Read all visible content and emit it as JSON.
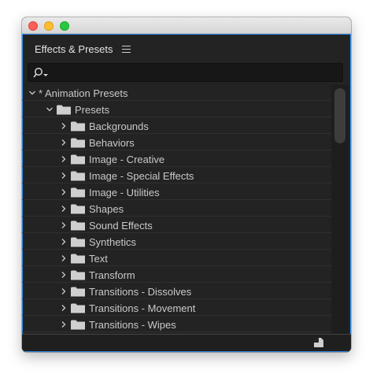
{
  "window": {
    "traffic_lights": [
      {
        "name": "close",
        "color": "#fd5f57"
      },
      {
        "name": "minimize",
        "color": "#febc2e"
      },
      {
        "name": "maximize",
        "color": "#28c840"
      }
    ]
  },
  "panel": {
    "title": "Effects & Presets",
    "menu_icon": "hamburger-menu-icon",
    "accent_color": "#2d8ceb"
  },
  "search": {
    "icon": "search-dropdown-icon",
    "value": "",
    "placeholder": ""
  },
  "tree": [
    {
      "label": "* Animation Presets",
      "level": 0,
      "expanded": true,
      "folder": false
    },
    {
      "label": "Presets",
      "level": 1,
      "expanded": true,
      "folder": true
    },
    {
      "label": "Backgrounds",
      "level": 2,
      "expanded": false,
      "folder": true
    },
    {
      "label": "Behaviors",
      "level": 2,
      "expanded": false,
      "folder": true
    },
    {
      "label": "Image - Creative",
      "level": 2,
      "expanded": false,
      "folder": true
    },
    {
      "label": "Image - Special Effects",
      "level": 2,
      "expanded": false,
      "folder": true
    },
    {
      "label": "Image - Utilities",
      "level": 2,
      "expanded": false,
      "folder": true
    },
    {
      "label": "Shapes",
      "level": 2,
      "expanded": false,
      "folder": true
    },
    {
      "label": "Sound Effects",
      "level": 2,
      "expanded": false,
      "folder": true
    },
    {
      "label": "Synthetics",
      "level": 2,
      "expanded": false,
      "folder": true
    },
    {
      "label": "Text",
      "level": 2,
      "expanded": false,
      "folder": true
    },
    {
      "label": "Transform",
      "level": 2,
      "expanded": false,
      "folder": true
    },
    {
      "label": "Transitions - Dissolves",
      "level": 2,
      "expanded": false,
      "folder": true
    },
    {
      "label": "Transitions - Movement",
      "level": 2,
      "expanded": false,
      "folder": true
    },
    {
      "label": "Transitions - Wipes",
      "level": 2,
      "expanded": false,
      "folder": true
    }
  ],
  "footer": {
    "new_bin_icon": "new-item-icon"
  }
}
